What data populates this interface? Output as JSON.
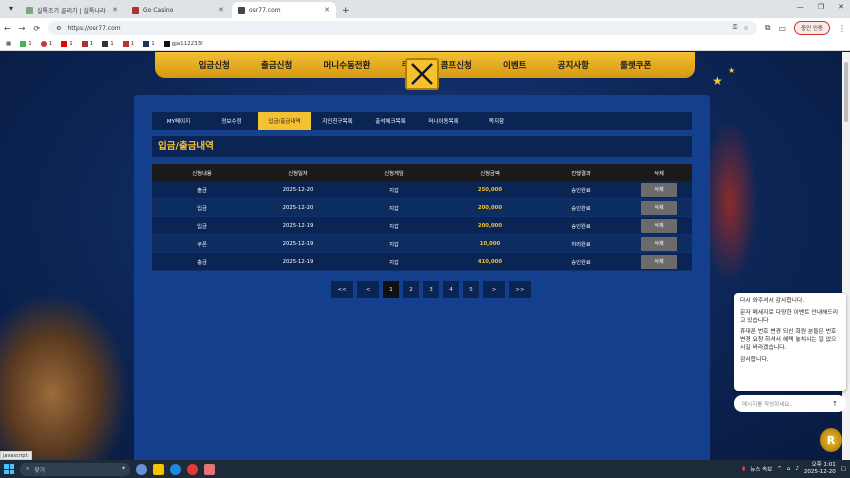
{
  "browser": {
    "tabs": [
      {
        "title": "실톡조기 골리기 | 실톡나라 - ...",
        "active": false
      },
      {
        "title": "Go Casino",
        "active": false
      },
      {
        "title": "osr77.com",
        "active": true
      }
    ],
    "url": "https://osr77.com",
    "profile_button": "중인 인증",
    "bookmarks": [
      "1",
      "1",
      "1",
      "1",
      "1",
      "1",
      "1",
      "gja112233l"
    ]
  },
  "site": {
    "main_nav": [
      "입금신청",
      "출금신청",
      "머니수동전환",
      "쿠",
      "콤프신청",
      "이벤트",
      "공지사항",
      "룰렛쿠폰"
    ],
    "sub_nav": [
      {
        "label": "MY페이지",
        "active": false
      },
      {
        "label": "정보수정",
        "active": false
      },
      {
        "label": "입금/출금내역",
        "active": true
      },
      {
        "label": "지인친구목록",
        "active": false
      },
      {
        "label": "출석체크목록",
        "active": false
      },
      {
        "label": "머니이동목록",
        "active": false
      },
      {
        "label": "쪽지함",
        "active": false
      }
    ],
    "page_title": "입금/출금내역",
    "table": {
      "headers": [
        "신청내용",
        "신청일자",
        "신청게임",
        "신청금액",
        "진행결과",
        "삭제"
      ],
      "rows": [
        {
          "type": "출금",
          "date": "2025-12-20",
          "game": "지갑",
          "amount": "250,000",
          "status": "승인완료",
          "action": "삭제"
        },
        {
          "type": "입금",
          "date": "2025-12-20",
          "game": "지갑",
          "amount": "200,000",
          "status": "승인완료",
          "action": "삭제"
        },
        {
          "type": "입금",
          "date": "2025-12-19",
          "game": "지갑",
          "amount": "200,000",
          "status": "승인완료",
          "action": "삭제"
        },
        {
          "type": "쿠폰",
          "date": "2025-12-19",
          "game": "지갑",
          "amount": "10,000",
          "status": "처리완료",
          "action": "삭제"
        },
        {
          "type": "충금",
          "date": "2025-12-19",
          "game": "지갑",
          "amount": "410,000",
          "status": "승인완료",
          "action": "삭제"
        }
      ]
    },
    "pagination": {
      "first": "<<",
      "prev": "<",
      "pages": [
        "1",
        "2",
        "3",
        "4",
        "5"
      ],
      "current": "1",
      "next": ">",
      "last": ">>"
    }
  },
  "chat": {
    "messages": [
      "다시 와주셔서 감사합니다.",
      "문자 메세지로 다양한 이벤트 안내해드리고 있습니다",
      "휴대폰 번호 변경 되신 회원 분들은 번호 변경 요청 하셔서 혜택 놓치시는 일 없으시길 바라겠습니다.",
      "감사합니다."
    ],
    "input_placeholder": "메시지를 작성하세요.."
  },
  "status_bar": "javascript:",
  "taskbar": {
    "search_placeholder": "찾기",
    "news": "뉴스 속보",
    "time": "오후 1:01",
    "date": "2025-12-20"
  }
}
